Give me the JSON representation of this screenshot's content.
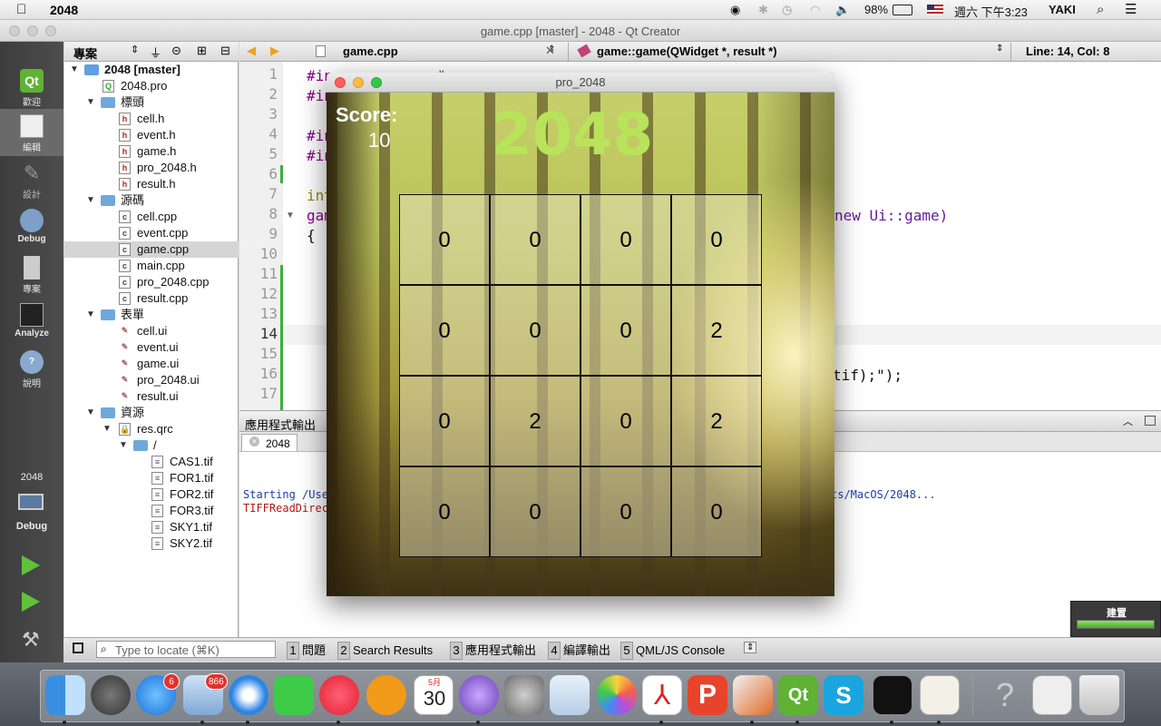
{
  "menubar": {
    "app_name": "2048",
    "battery": "98%",
    "clock": "週六 下午3:23",
    "user": "YAKI"
  },
  "window": {
    "title": "game.cpp [master] - 2048 - Qt Creator"
  },
  "modes": [
    {
      "label": "歡迎",
      "icon": "qt-welcome-icon"
    },
    {
      "label": "編輯",
      "icon": "edit-icon"
    },
    {
      "label": "設計",
      "icon": "design-icon"
    },
    {
      "label": "Debug",
      "icon": "debug-icon"
    },
    {
      "label": "專案",
      "icon": "projects-icon"
    },
    {
      "label": "Analyze",
      "icon": "analyze-icon"
    },
    {
      "label": "說明",
      "icon": "help-icon"
    }
  ],
  "kit": {
    "project": "2048",
    "config": "Debug"
  },
  "project_pane": {
    "title": "專案"
  },
  "tree": [
    {
      "label": "2048 [master]",
      "level": 0,
      "kind": "project",
      "arrow": "down",
      "bold": true
    },
    {
      "label": "2048.pro",
      "level": 1,
      "kind": "pro"
    },
    {
      "label": "標頭",
      "level": 1,
      "kind": "folder-h",
      "arrow": "down"
    },
    {
      "label": "cell.h",
      "level": 2,
      "kind": "h"
    },
    {
      "label": "event.h",
      "level": 2,
      "kind": "h"
    },
    {
      "label": "game.h",
      "level": 2,
      "kind": "h"
    },
    {
      "label": "pro_2048.h",
      "level": 2,
      "kind": "h"
    },
    {
      "label": "result.h",
      "level": 2,
      "kind": "h"
    },
    {
      "label": "源碼",
      "level": 1,
      "kind": "folder-cpp",
      "arrow": "down"
    },
    {
      "label": "cell.cpp",
      "level": 2,
      "kind": "cpp"
    },
    {
      "label": "event.cpp",
      "level": 2,
      "kind": "cpp"
    },
    {
      "label": "game.cpp",
      "level": 2,
      "kind": "cpp",
      "selected": true
    },
    {
      "label": "main.cpp",
      "level": 2,
      "kind": "cpp"
    },
    {
      "label": "pro_2048.cpp",
      "level": 2,
      "kind": "cpp"
    },
    {
      "label": "result.cpp",
      "level": 2,
      "kind": "cpp"
    },
    {
      "label": "表單",
      "level": 1,
      "kind": "folder-ui",
      "arrow": "down"
    },
    {
      "label": "cell.ui",
      "level": 2,
      "kind": "ui"
    },
    {
      "label": "event.ui",
      "level": 2,
      "kind": "ui"
    },
    {
      "label": "game.ui",
      "level": 2,
      "kind": "ui"
    },
    {
      "label": "pro_2048.ui",
      "level": 2,
      "kind": "ui"
    },
    {
      "label": "result.ui",
      "level": 2,
      "kind": "ui"
    },
    {
      "label": "資源",
      "level": 1,
      "kind": "folder-res",
      "arrow": "down"
    },
    {
      "label": "res.qrc",
      "level": 2,
      "kind": "qrc",
      "arrow": "down"
    },
    {
      "label": "/",
      "level": 3,
      "kind": "folder",
      "arrow": "down"
    },
    {
      "label": "CAS1.tif",
      "level": 4,
      "kind": "tif"
    },
    {
      "label": "FOR1.tif",
      "level": 4,
      "kind": "tif"
    },
    {
      "label": "FOR2.tif",
      "level": 4,
      "kind": "tif"
    },
    {
      "label": "FOR3.tif",
      "level": 4,
      "kind": "tif"
    },
    {
      "label": "SKY1.tif",
      "level": 4,
      "kind": "tif"
    },
    {
      "label": "SKY2.tif",
      "level": 4,
      "kind": "tif"
    }
  ],
  "editor": {
    "file": "game.cpp",
    "symbol": "game::game(QWidget *, result *)",
    "cursor": "Line: 14, Col: 8",
    "line_numbers": [
      "1",
      "2",
      "3",
      "4",
      "5",
      "6",
      "7",
      "8",
      "9",
      "10",
      "11",
      "12",
      "13",
      "14",
      "15",
      "16",
      "17"
    ],
    "visible_code": [
      {
        "line": 1,
        "text": "#in"
      },
      {
        "line": 1,
        "text": "\""
      },
      {
        "line": 2,
        "text": "#in"
      },
      {
        "line": 4,
        "text": "#in"
      },
      {
        "line": 5,
        "text": "#in"
      },
      {
        "line": 7,
        "text": "int"
      },
      {
        "line": 8,
        "text": "gam"
      },
      {
        "line": 9,
        "text": "{"
      },
      {
        "line": 8,
        "text": "new Ui::game)"
      },
      {
        "line": 16,
        "text": "tif);\");"
      }
    ]
  },
  "output": {
    "title": "應用程式輸出",
    "tab": "2048",
    "line1_left": "Starting /Use",
    "line1_right": "ts/MacOS/2048...",
    "line2_left": "TIFFReadDirec"
  },
  "statusbar": {
    "locate_placeholder": "Type to locate (⌘K)",
    "tabs": [
      {
        "num": "1",
        "label": "問題"
      },
      {
        "num": "2",
        "label": "Search Results"
      },
      {
        "num": "3",
        "label": "應用程式輸出"
      },
      {
        "num": "4",
        "label": "編譯輸出"
      },
      {
        "num": "5",
        "label": "QML/JS Console"
      }
    ],
    "build_label": "建置",
    "build_progress": 1.0
  },
  "game": {
    "window_title": "pro_2048",
    "score_label": "Score:",
    "score": "10",
    "title": "2048",
    "board": [
      [
        "0",
        "0",
        "0",
        "0"
      ],
      [
        "0",
        "0",
        "0",
        "2"
      ],
      [
        "0",
        "2",
        "0",
        "2"
      ],
      [
        "0",
        "0",
        "0",
        "0"
      ]
    ],
    "title_color": "#b8e35a"
  },
  "dock": {
    "badges": {
      "appstore": "6",
      "mail": "866"
    },
    "calendar_month": "5月",
    "calendar_day": "30"
  }
}
